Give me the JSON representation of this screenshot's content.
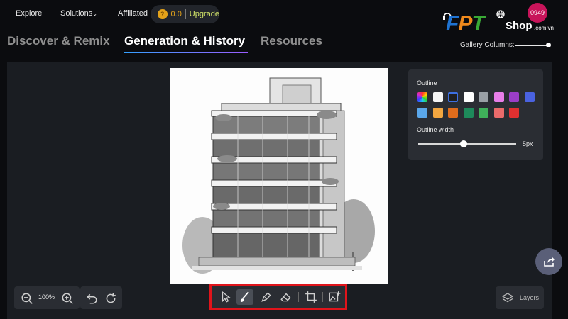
{
  "nav": {
    "explore": "Explore",
    "solutions": "Solutions",
    "affiliated": "Affiliated",
    "credits": "0.0",
    "upgrade": "Upgrade"
  },
  "brand": {
    "logo_text": "FPT",
    "shop": "Shop",
    "domain": ".com.vn",
    "badge": "0949"
  },
  "tabs": [
    {
      "label": "Discover & Remix",
      "active": false
    },
    {
      "label": "Generation & History",
      "active": true
    },
    {
      "label": "Resources",
      "active": false
    }
  ],
  "gallery": {
    "label": "Gallery Columns:",
    "value_fraction": 0.93
  },
  "outline": {
    "title": "Outline",
    "width_label": "Outline width",
    "width_value": "5px",
    "width_fraction": 0.43,
    "swatches": [
      "rainbow",
      "#f4f4f4",
      "#1f1f1f",
      "#ffffff",
      "#9aa0a6",
      "#e77ee8",
      "#9a3ec7",
      "#4a62e0",
      "#5aa7ea",
      "#f2a640",
      "#e06c1c",
      "#1e8a5b",
      "#3fb05a",
      "#ea6b6b",
      "#e03030"
    ],
    "selected_index": 2
  },
  "zoom": {
    "value": "100%"
  },
  "layers": {
    "label": "Layers"
  },
  "colors": {
    "accent": "#35a0ff",
    "highlight_border": "#e0141b",
    "upgrade": "#d6e86a",
    "coin": "#e3a21a"
  }
}
